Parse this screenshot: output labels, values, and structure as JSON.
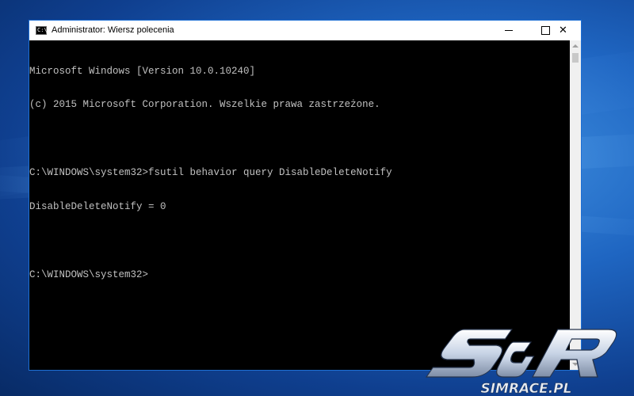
{
  "window": {
    "title": "Administrator: Wiersz polecenia",
    "icon_glyph": "C:\\",
    "controls": {
      "minimize_icon": "minimize-icon",
      "maximize_icon": "maximize-icon",
      "close_glyph": "✕"
    }
  },
  "console": {
    "lines": [
      "Microsoft Windows [Version 10.0.10240]",
      "(c) 2015 Microsoft Corporation. Wszelkie prawa zastrzeżone.",
      "",
      "C:\\WINDOWS\\system32>fsutil behavior query DisableDeleteNotify",
      "DisableDeleteNotify = 0",
      "",
      "C:\\WINDOWS\\system32>"
    ]
  },
  "watermark": {
    "logo_mark": "S&R",
    "site": "SIMRACE.PL"
  },
  "colors": {
    "console_bg": "#000000",
    "console_text": "#c0c0c0",
    "titlebar_bg": "#ffffff",
    "window_border": "#1e6fd4"
  }
}
